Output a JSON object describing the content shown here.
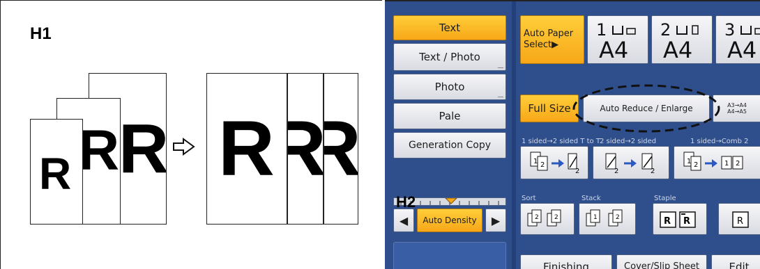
{
  "figure": {
    "left_label": "H1",
    "right_label": "H2",
    "sheet_letter": "R"
  },
  "mode_buttons": [
    {
      "label": "Text",
      "selected": true
    },
    {
      "label": "Text / Photo",
      "selected": false
    },
    {
      "label": "Photo",
      "selected": false
    },
    {
      "label": "Pale",
      "selected": false
    },
    {
      "label": "Generation Copy",
      "selected": false
    }
  ],
  "paper": {
    "auto_select_label": "Auto Paper Select▶",
    "trays": [
      {
        "number": "1",
        "size": "A4"
      },
      {
        "number": "2",
        "size": "A4"
      },
      {
        "number": "3",
        "size": "A4"
      }
    ]
  },
  "reduce": {
    "full_size_label": "Full Size",
    "auto_reduce_label": "Auto Reduce / Enlarge",
    "preset_label_line1": "A3→A4",
    "preset_label_line2": "A4→A5"
  },
  "duplex": {
    "labels": [
      "1 sided→2 sided T to T",
      "2 sided→2 sided",
      "1 sided→Comb 2"
    ]
  },
  "finishing_row": {
    "sort_label": "Sort",
    "stack_label": "Stack",
    "staple_label": "Staple"
  },
  "density": {
    "label": "Auto Density",
    "left_arrow": "◀",
    "right_arrow": "▶"
  },
  "bottom_tabs": [
    {
      "label": "Finishing"
    },
    {
      "label": "Cover/Slip Sheet"
    },
    {
      "label": "Edit"
    }
  ],
  "colors": {
    "selected_orange": "#f7a718",
    "panel_blue": "#2f4f8c",
    "button_face": "#e6e7ec"
  }
}
